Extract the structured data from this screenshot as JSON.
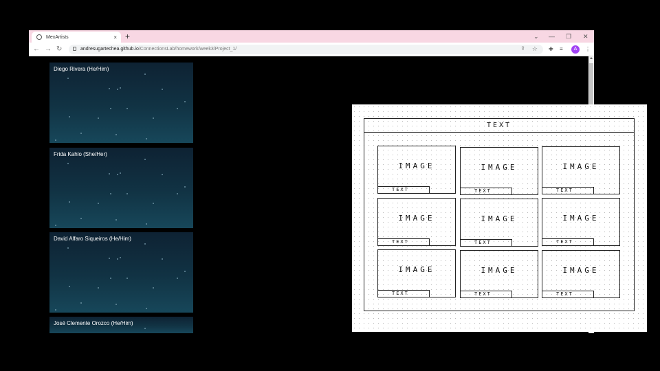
{
  "browser": {
    "tab_title": "MexArtists",
    "tab_close": "×",
    "new_tab": "+",
    "controls": {
      "dropdown": "⌄",
      "minimize": "—",
      "restore": "❐",
      "close": "✕"
    },
    "nav": {
      "back": "←",
      "forward": "→",
      "reload": "↻"
    },
    "url_host": "andresugartechea.github.io",
    "url_path": "/ConnectionsLab/homework/week3/Project_1/",
    "profile_initial": "A"
  },
  "cards": [
    {
      "name": "Diego Rivera (He/Him)"
    },
    {
      "name": "Frida Kahlo (She/Her)"
    },
    {
      "name": "David Alfaro Siqueiros (He/Him)"
    },
    {
      "name": "José Clemente Orozco (He/Him)"
    }
  ],
  "wireframe": {
    "header": "TEXT",
    "cells": [
      {
        "image": "IMAGE",
        "text": "TEXT"
      },
      {
        "image": "IMAGE",
        "text": "TEXT"
      },
      {
        "image": "IMAGE",
        "text": "TEXT"
      },
      {
        "image": "IMAGE",
        "text": "TEXT"
      },
      {
        "image": "IMAGE",
        "text": "TEXT"
      },
      {
        "image": "IMAGE",
        "text": "TEXT"
      },
      {
        "image": "IMAGE",
        "text": "TEXT"
      },
      {
        "image": "IMAGE",
        "text": "TEXT"
      },
      {
        "image": "IMAGE",
        "text": "TEXT"
      }
    ]
  }
}
